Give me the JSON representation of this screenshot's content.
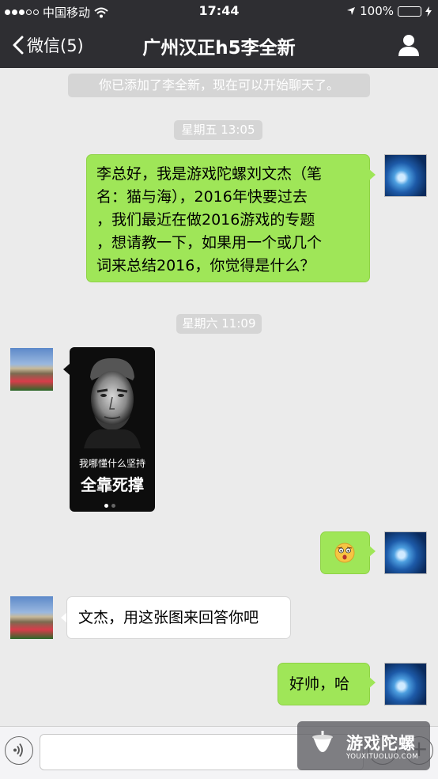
{
  "status_bar": {
    "carrier": "中国移动",
    "time": "17:44",
    "battery": "100%",
    "battery_level": 1.0
  },
  "nav": {
    "back_label": "微信(5)",
    "title": "广州汉正h5李全新"
  },
  "chat": {
    "system_notice": "你已添加了李全新，现在可以开始聊天了。",
    "timestamp_1": "星期五 13:05",
    "message_1": "李总好，我是游戏陀螺刘文杰（笔名：猫与海），2016年快要过去，我们最近在做2016游戏的专题，想请教一下，如果用一个或几个词来总结2016，你觉得是什么？",
    "message_1_lines": [
      "李总好，我是游戏陀螺刘文杰（笔",
      "名：猫与海），2016年快要过去",
      "，我们最近在做2016游戏的专题",
      "，想请教一下，如果用一个或几个",
      "词来总结2016，你觉得是什么？"
    ],
    "timestamp_2": "星期六 11:09",
    "image_caption_small": "我哪懂什么坚持",
    "image_caption_large": "全靠死撑",
    "message_3": "文杰，用这张图来回答你吧",
    "message_4": "好帅，哈"
  },
  "watermark": {
    "name": "游戏陀螺",
    "url": "YOUXITUOLUO.COM"
  },
  "colors": {
    "nav_bg": "#2e2e32",
    "chat_bg": "#ebebeb",
    "my_bubble": "#9fe658",
    "other_bubble": "#ffffff",
    "battery_fill": "#4cd964"
  }
}
